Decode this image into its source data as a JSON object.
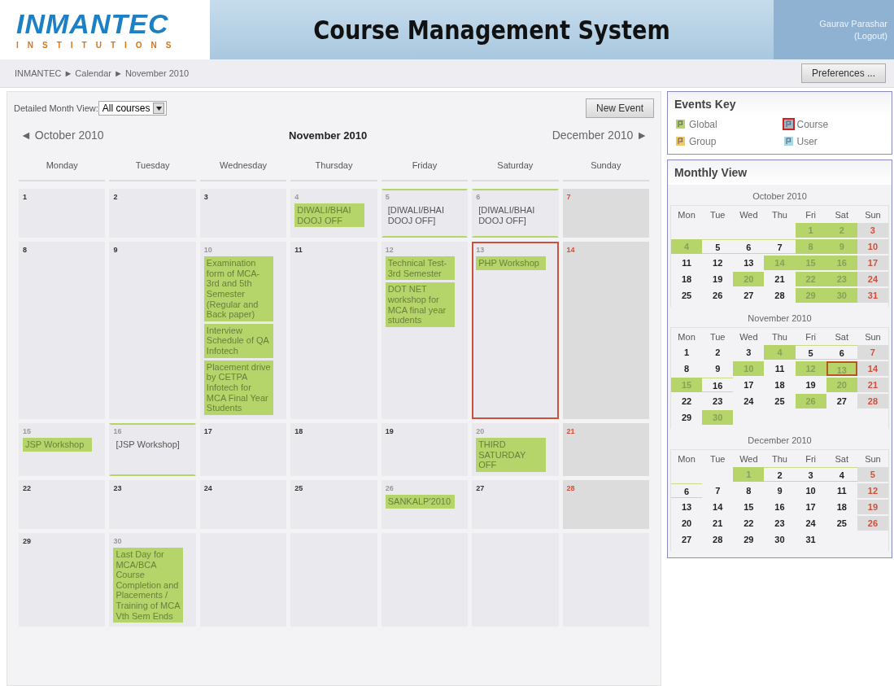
{
  "header": {
    "logo": {
      "name": "INMANTEC",
      "tagline": "INSTITUTIONS"
    },
    "title": "Course Management System",
    "user": {
      "name": "Gaurav Parashar",
      "logout": "(Logout)"
    }
  },
  "breadcrumb": {
    "separator": "►",
    "items": [
      "INMANTEC",
      "Calendar",
      "November 2010"
    ]
  },
  "preferences_button": "Preferences ...",
  "filter": {
    "label": "Detailed Month View:",
    "value": "All courses"
  },
  "new_event_button": "New Event",
  "nav": {
    "prev": {
      "arrow": "◄",
      "label": "October 2010"
    },
    "current": "November 2010",
    "next": {
      "arrow": "►",
      "label": "December 2010"
    }
  },
  "weekdays": [
    "Monday",
    "Tuesday",
    "Wednesday",
    "Thursday",
    "Friday",
    "Saturday",
    "Sunday"
  ],
  "weeks": [
    [
      {
        "kind": "day",
        "num": "1",
        "weekend": false,
        "today": false,
        "span": false
      },
      {
        "kind": "day",
        "num": "2",
        "weekend": false,
        "today": false,
        "span": false
      },
      {
        "kind": "day",
        "num": "3",
        "weekend": false,
        "today": false,
        "span": false
      },
      {
        "kind": "day",
        "num": "4",
        "weekend": false,
        "today": false,
        "span": false,
        "events": [
          {
            "kind": "global",
            "text": "DIWALI/BHAI DOOJ OFF"
          }
        ]
      },
      {
        "kind": "day",
        "num": "5",
        "weekend": false,
        "today": false,
        "span": true,
        "events": [
          {
            "kind": "continued",
            "text": "[DIWALI/BHAI DOOJ OFF]"
          }
        ]
      },
      {
        "kind": "day",
        "num": "6",
        "weekend": false,
        "today": false,
        "span": true,
        "events": [
          {
            "kind": "continued",
            "text": "[DIWALI/BHAI DOOJ OFF]"
          }
        ]
      },
      {
        "kind": "day",
        "num": "7",
        "weekend": true,
        "today": false,
        "span": false
      }
    ],
    [
      {
        "kind": "day",
        "num": "8",
        "weekend": false,
        "today": false,
        "span": false
      },
      {
        "kind": "day",
        "num": "9",
        "weekend": false,
        "today": false,
        "span": false
      },
      {
        "kind": "day",
        "num": "10",
        "weekend": false,
        "today": false,
        "span": false,
        "events": [
          {
            "kind": "global",
            "text": "Examination form of MCA-3rd and 5th Semester (Regular and Back paper)"
          },
          {
            "kind": "global",
            "text": "Interview Schedule of QA Infotech"
          },
          {
            "kind": "global",
            "text": "Placement drive by CETPA Infotech for MCA Final Year Students"
          }
        ]
      },
      {
        "kind": "day",
        "num": "11",
        "weekend": false,
        "today": false,
        "span": false
      },
      {
        "kind": "day",
        "num": "12",
        "weekend": false,
        "today": false,
        "span": false,
        "events": [
          {
            "kind": "global",
            "text": "Technical Test-3rd Semester"
          },
          {
            "kind": "global",
            "text": "DOT NET workshop for MCA final year students"
          }
        ]
      },
      {
        "kind": "day",
        "num": "13",
        "weekend": false,
        "today": true,
        "span": false,
        "events": [
          {
            "kind": "global",
            "text": "PHP Workshop"
          }
        ]
      },
      {
        "kind": "day",
        "num": "14",
        "weekend": true,
        "today": false,
        "span": false
      }
    ],
    [
      {
        "kind": "day",
        "num": "15",
        "weekend": false,
        "today": false,
        "span": false,
        "events": [
          {
            "kind": "global",
            "text": "JSP Workshop"
          }
        ]
      },
      {
        "kind": "day",
        "num": "16",
        "weekend": false,
        "today": false,
        "span": true,
        "events": [
          {
            "kind": "continued",
            "text": "[JSP Workshop]"
          }
        ]
      },
      {
        "kind": "day",
        "num": "17",
        "weekend": false,
        "today": false,
        "span": false
      },
      {
        "kind": "day",
        "num": "18",
        "weekend": false,
        "today": false,
        "span": false
      },
      {
        "kind": "day",
        "num": "19",
        "weekend": false,
        "today": false,
        "span": false
      },
      {
        "kind": "day",
        "num": "20",
        "weekend": false,
        "today": false,
        "span": false,
        "events": [
          {
            "kind": "global",
            "text": "THIRD SATURDAY OFF"
          }
        ]
      },
      {
        "kind": "day",
        "num": "21",
        "weekend": true,
        "today": false,
        "span": false
      }
    ],
    [
      {
        "kind": "day",
        "num": "22",
        "weekend": false,
        "today": false,
        "span": false
      },
      {
        "kind": "day",
        "num": "23",
        "weekend": false,
        "today": false,
        "span": false
      },
      {
        "kind": "day",
        "num": "24",
        "weekend": false,
        "today": false,
        "span": false
      },
      {
        "kind": "day",
        "num": "25",
        "weekend": false,
        "today": false,
        "span": false
      },
      {
        "kind": "day",
        "num": "26",
        "weekend": false,
        "today": false,
        "span": false,
        "events": [
          {
            "kind": "global",
            "text": "SANKALP'2010"
          }
        ]
      },
      {
        "kind": "day",
        "num": "27",
        "weekend": false,
        "today": false,
        "span": false
      },
      {
        "kind": "day",
        "num": "28",
        "weekend": true,
        "today": false,
        "span": false
      }
    ],
    [
      {
        "kind": "day",
        "num": "29",
        "weekend": false,
        "today": false,
        "span": false
      },
      {
        "kind": "day",
        "num": "30",
        "weekend": false,
        "today": false,
        "span": false,
        "events": [
          {
            "kind": "global",
            "text": "Last Day for MCA/BCA Course Completion and Placements / Training of MCA Vth Sem Ends"
          }
        ]
      },
      {
        "kind": "blank"
      },
      {
        "kind": "blank"
      },
      {
        "kind": "blank"
      },
      {
        "kind": "blank"
      },
      {
        "kind": "blank"
      }
    ]
  ],
  "events_key": {
    "title": "Events Key",
    "items": [
      {
        "label": "Global",
        "color": "#b5d56a",
        "highlighted": false
      },
      {
        "label": "Course",
        "color": "#9fb8c8",
        "highlighted": true
      },
      {
        "label": "Group",
        "color": "#f3c863",
        "highlighted": false
      },
      {
        "label": "User",
        "color": "#a8d8e6",
        "highlighted": false
      }
    ]
  },
  "monthly_view": {
    "title": "Monthly View",
    "months": [
      {
        "title": "October 2010",
        "weekdays": [
          "Mon",
          "Tue",
          "Wed",
          "Thu",
          "Fri",
          "Sat",
          "Sun"
        ],
        "weeks": [
          [
            {
              "kind": "blank"
            },
            {
              "kind": "blank"
            },
            {
              "kind": "blank"
            },
            {
              "kind": "blank"
            },
            {
              "kind": "day",
              "d": "1",
              "event": true,
              "weekend": false,
              "today": false,
              "span": false
            },
            {
              "kind": "day",
              "d": "2",
              "event": true,
              "weekend": false,
              "today": false,
              "span": false
            },
            {
              "kind": "day",
              "d": "3",
              "event": false,
              "weekend": true,
              "today": false,
              "span": false
            }
          ],
          [
            {
              "kind": "day",
              "d": "4",
              "event": true,
              "weekend": false,
              "today": false,
              "span": false
            },
            {
              "kind": "day",
              "d": "5",
              "event": false,
              "weekend": false,
              "today": false,
              "span": true
            },
            {
              "kind": "day",
              "d": "6",
              "event": false,
              "weekend": false,
              "today": false,
              "span": true
            },
            {
              "kind": "day",
              "d": "7",
              "event": false,
              "weekend": false,
              "today": false,
              "span": true
            },
            {
              "kind": "day",
              "d": "8",
              "event": true,
              "weekend": false,
              "today": false,
              "span": false
            },
            {
              "kind": "day",
              "d": "9",
              "event": true,
              "weekend": false,
              "today": false,
              "span": false
            },
            {
              "kind": "day",
              "d": "10",
              "event": false,
              "weekend": true,
              "today": false,
              "span": false
            }
          ],
          [
            {
              "kind": "day",
              "d": "11",
              "event": false,
              "weekend": false,
              "today": false,
              "span": false
            },
            {
              "kind": "day",
              "d": "12",
              "event": false,
              "weekend": false,
              "today": false,
              "span": false
            },
            {
              "kind": "day",
              "d": "13",
              "event": false,
              "weekend": false,
              "today": false,
              "span": false
            },
            {
              "kind": "day",
              "d": "14",
              "event": true,
              "weekend": false,
              "today": false,
              "span": false
            },
            {
              "kind": "day",
              "d": "15",
              "event": true,
              "weekend": false,
              "today": false,
              "span": false
            },
            {
              "kind": "day",
              "d": "16",
              "event": true,
              "weekend": false,
              "today": false,
              "span": false
            },
            {
              "kind": "day",
              "d": "17",
              "event": false,
              "weekend": true,
              "today": false,
              "span": false
            }
          ],
          [
            {
              "kind": "day",
              "d": "18",
              "event": false,
              "weekend": false,
              "today": false,
              "span": false
            },
            {
              "kind": "day",
              "d": "19",
              "event": false,
              "weekend": false,
              "today": false,
              "span": false
            },
            {
              "kind": "day",
              "d": "20",
              "event": true,
              "weekend": false,
              "today": false,
              "span": false
            },
            {
              "kind": "day",
              "d": "21",
              "event": false,
              "weekend": false,
              "today": false,
              "span": false
            },
            {
              "kind": "day",
              "d": "22",
              "event": true,
              "weekend": false,
              "today": false,
              "span": false
            },
            {
              "kind": "day",
              "d": "23",
              "event": true,
              "weekend": false,
              "today": false,
              "span": false
            },
            {
              "kind": "day",
              "d": "24",
              "event": false,
              "weekend": true,
              "today": false,
              "span": false
            }
          ],
          [
            {
              "kind": "day",
              "d": "25",
              "event": false,
              "weekend": false,
              "today": false,
              "span": false
            },
            {
              "kind": "day",
              "d": "26",
              "event": false,
              "weekend": false,
              "today": false,
              "span": false
            },
            {
              "kind": "day",
              "d": "27",
              "event": false,
              "weekend": false,
              "today": false,
              "span": false
            },
            {
              "kind": "day",
              "d": "28",
              "event": false,
              "weekend": false,
              "today": false,
              "span": false
            },
            {
              "kind": "day",
              "d": "29",
              "event": true,
              "weekend": false,
              "today": false,
              "span": false
            },
            {
              "kind": "day",
              "d": "30",
              "event": true,
              "weekend": false,
              "today": false,
              "span": false
            },
            {
              "kind": "day",
              "d": "31",
              "event": false,
              "weekend": true,
              "today": false,
              "span": false
            }
          ]
        ]
      },
      {
        "title": "November 2010",
        "weekdays": [
          "Mon",
          "Tue",
          "Wed",
          "Thu",
          "Fri",
          "Sat",
          "Sun"
        ],
        "weeks": [
          [
            {
              "kind": "day",
              "d": "1",
              "event": false,
              "weekend": false,
              "today": false,
              "span": false
            },
            {
              "kind": "day",
              "d": "2",
              "event": false,
              "weekend": false,
              "today": false,
              "span": false
            },
            {
              "kind": "day",
              "d": "3",
              "event": false,
              "weekend": false,
              "today": false,
              "span": false
            },
            {
              "kind": "day",
              "d": "4",
              "event": true,
              "weekend": false,
              "today": false,
              "span": false
            },
            {
              "kind": "day",
              "d": "5",
              "event": false,
              "weekend": false,
              "today": false,
              "span": true
            },
            {
              "kind": "day",
              "d": "6",
              "event": false,
              "weekend": false,
              "today": false,
              "span": true
            },
            {
              "kind": "day",
              "d": "7",
              "event": false,
              "weekend": true,
              "today": false,
              "span": false
            }
          ],
          [
            {
              "kind": "day",
              "d": "8",
              "event": false,
              "weekend": false,
              "today": false,
              "span": false
            },
            {
              "kind": "day",
              "d": "9",
              "event": false,
              "weekend": false,
              "today": false,
              "span": false
            },
            {
              "kind": "day",
              "d": "10",
              "event": true,
              "weekend": false,
              "today": false,
              "span": false
            },
            {
              "kind": "day",
              "d": "11",
              "event": false,
              "weekend": false,
              "today": false,
              "span": false
            },
            {
              "kind": "day",
              "d": "12",
              "event": true,
              "weekend": false,
              "today": false,
              "span": false
            },
            {
              "kind": "day",
              "d": "13",
              "event": true,
              "weekend": false,
              "today": true,
              "span": false
            },
            {
              "kind": "day",
              "d": "14",
              "event": false,
              "weekend": true,
              "today": false,
              "span": false
            }
          ],
          [
            {
              "kind": "day",
              "d": "15",
              "event": true,
              "weekend": false,
              "today": false,
              "span": false
            },
            {
              "kind": "day",
              "d": "16",
              "event": false,
              "weekend": false,
              "today": false,
              "span": true
            },
            {
              "kind": "day",
              "d": "17",
              "event": false,
              "weekend": false,
              "today": false,
              "span": false
            },
            {
              "kind": "day",
              "d": "18",
              "event": false,
              "weekend": false,
              "today": false,
              "span": false
            },
            {
              "kind": "day",
              "d": "19",
              "event": false,
              "weekend": false,
              "today": false,
              "span": false
            },
            {
              "kind": "day",
              "d": "20",
              "event": true,
              "weekend": false,
              "today": false,
              "span": false
            },
            {
              "kind": "day",
              "d": "21",
              "event": false,
              "weekend": true,
              "today": false,
              "span": false
            }
          ],
          [
            {
              "kind": "day",
              "d": "22",
              "event": false,
              "weekend": false,
              "today": false,
              "span": false
            },
            {
              "kind": "day",
              "d": "23",
              "event": false,
              "weekend": false,
              "today": false,
              "span": false
            },
            {
              "kind": "day",
              "d": "24",
              "event": false,
              "weekend": false,
              "today": false,
              "span": false
            },
            {
              "kind": "day",
              "d": "25",
              "event": false,
              "weekend": false,
              "today": false,
              "span": false
            },
            {
              "kind": "day",
              "d": "26",
              "event": true,
              "weekend": false,
              "today": false,
              "span": false
            },
            {
              "kind": "day",
              "d": "27",
              "event": false,
              "weekend": false,
              "today": false,
              "span": false
            },
            {
              "kind": "day",
              "d": "28",
              "event": false,
              "weekend": true,
              "today": false,
              "span": false
            }
          ],
          [
            {
              "kind": "day",
              "d": "29",
              "event": false,
              "weekend": false,
              "today": false,
              "span": false
            },
            {
              "kind": "day",
              "d": "30",
              "event": true,
              "weekend": false,
              "today": false,
              "span": false
            },
            {
              "kind": "blank"
            },
            {
              "kind": "blank"
            },
            {
              "kind": "blank"
            },
            {
              "kind": "blank"
            },
            {
              "kind": "blank"
            }
          ]
        ]
      },
      {
        "title": "December 2010",
        "weekdays": [
          "Mon",
          "Tue",
          "Wed",
          "Thu",
          "Fri",
          "Sat",
          "Sun"
        ],
        "weeks": [
          [
            {
              "kind": "blank"
            },
            {
              "kind": "blank"
            },
            {
              "kind": "day",
              "d": "1",
              "event": true,
              "weekend": false,
              "today": false,
              "span": false
            },
            {
              "kind": "day",
              "d": "2",
              "event": false,
              "weekend": false,
              "today": false,
              "span": true
            },
            {
              "kind": "day",
              "d": "3",
              "event": false,
              "weekend": false,
              "today": false,
              "span": true
            },
            {
              "kind": "day",
              "d": "4",
              "event": false,
              "weekend": false,
              "today": false,
              "span": true
            },
            {
              "kind": "day",
              "d": "5",
              "event": false,
              "weekend": true,
              "today": false,
              "span": false
            }
          ],
          [
            {
              "kind": "day",
              "d": "6",
              "event": false,
              "weekend": false,
              "today": false,
              "span": true
            },
            {
              "kind": "day",
              "d": "7",
              "event": false,
              "weekend": false,
              "today": false,
              "span": false
            },
            {
              "kind": "day",
              "d": "8",
              "event": false,
              "weekend": false,
              "today": false,
              "span": false
            },
            {
              "kind": "day",
              "d": "9",
              "event": false,
              "weekend": false,
              "today": false,
              "span": false
            },
            {
              "kind": "day",
              "d": "10",
              "event": false,
              "weekend": false,
              "today": false,
              "span": false
            },
            {
              "kind": "day",
              "d": "11",
              "event": false,
              "weekend": false,
              "today": false,
              "span": false
            },
            {
              "kind": "day",
              "d": "12",
              "event": false,
              "weekend": true,
              "today": false,
              "span": false
            }
          ],
          [
            {
              "kind": "day",
              "d": "13",
              "event": false,
              "weekend": false,
              "today": false,
              "span": false
            },
            {
              "kind": "day",
              "d": "14",
              "event": false,
              "weekend": false,
              "today": false,
              "span": false
            },
            {
              "kind": "day",
              "d": "15",
              "event": false,
              "weekend": false,
              "today": false,
              "span": false
            },
            {
              "kind": "day",
              "d": "16",
              "event": false,
              "weekend": false,
              "today": false,
              "span": false
            },
            {
              "kind": "day",
              "d": "17",
              "event": false,
              "weekend": false,
              "today": false,
              "span": false
            },
            {
              "kind": "day",
              "d": "18",
              "event": false,
              "weekend": false,
              "today": false,
              "span": false
            },
            {
              "kind": "day",
              "d": "19",
              "event": false,
              "weekend": true,
              "today": false,
              "span": false
            }
          ],
          [
            {
              "kind": "day",
              "d": "20",
              "event": false,
              "weekend": false,
              "today": false,
              "span": false
            },
            {
              "kind": "day",
              "d": "21",
              "event": false,
              "weekend": false,
              "today": false,
              "span": false
            },
            {
              "kind": "day",
              "d": "22",
              "event": false,
              "weekend": false,
              "today": false,
              "span": false
            },
            {
              "kind": "day",
              "d": "23",
              "event": false,
              "weekend": false,
              "today": false,
              "span": false
            },
            {
              "kind": "day",
              "d": "24",
              "event": false,
              "weekend": false,
              "today": false,
              "span": false
            },
            {
              "kind": "day",
              "d": "25",
              "event": false,
              "weekend": false,
              "today": false,
              "span": false
            },
            {
              "kind": "day",
              "d": "26",
              "event": false,
              "weekend": true,
              "today": false,
              "span": false
            }
          ],
          [
            {
              "kind": "day",
              "d": "27",
              "event": false,
              "weekend": false,
              "today": false,
              "span": false
            },
            {
              "kind": "day",
              "d": "28",
              "event": false,
              "weekend": false,
              "today": false,
              "span": false
            },
            {
              "kind": "day",
              "d": "29",
              "event": false,
              "weekend": false,
              "today": false,
              "span": false
            },
            {
              "kind": "day",
              "d": "30",
              "event": false,
              "weekend": false,
              "today": false,
              "span": false
            },
            {
              "kind": "day",
              "d": "31",
              "event": false,
              "weekend": false,
              "today": false,
              "span": false
            },
            {
              "kind": "blank"
            },
            {
              "kind": "blank"
            }
          ]
        ]
      }
    ]
  }
}
